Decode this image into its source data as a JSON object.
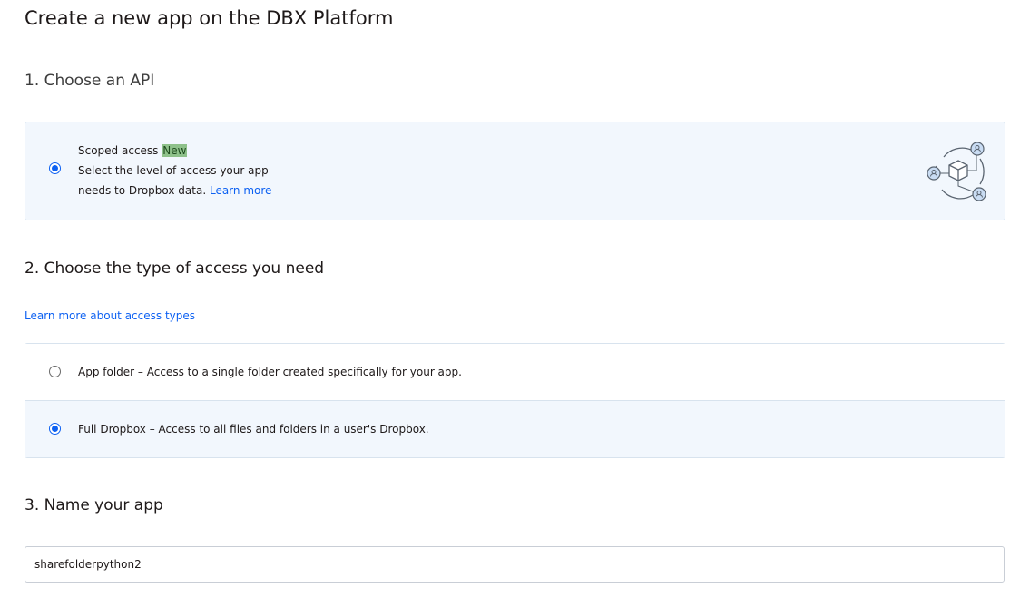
{
  "page_title": "Create a new app on the DBX Platform",
  "step1": {
    "heading": "1. Choose an API",
    "option": {
      "title": "Scoped access",
      "badge": "New",
      "description_line1": "Select the level of access your app",
      "description_line2": "needs to Dropbox data.",
      "learn_more": "Learn more",
      "selected": true,
      "illustration_icon": "scoped-access-illustration-icon"
    }
  },
  "step2": {
    "heading": "2. Choose the type of access you need",
    "learn_more_link": "Learn more about access types",
    "options": [
      {
        "name": "App folder",
        "description": "– Access to a single folder created specifically for your app.",
        "selected": false
      },
      {
        "name": "Full Dropbox",
        "description": "– Access to all files and folders in a user's Dropbox.",
        "selected": true
      }
    ]
  },
  "step3": {
    "heading": "3. Name your app",
    "app_name_value": "sharefolderpython2"
  },
  "colors": {
    "accent": "#0d61f2",
    "selected_bg": "#f2f7fd",
    "badge_bg": "#8ec18a",
    "border": "#d8e3ee"
  }
}
